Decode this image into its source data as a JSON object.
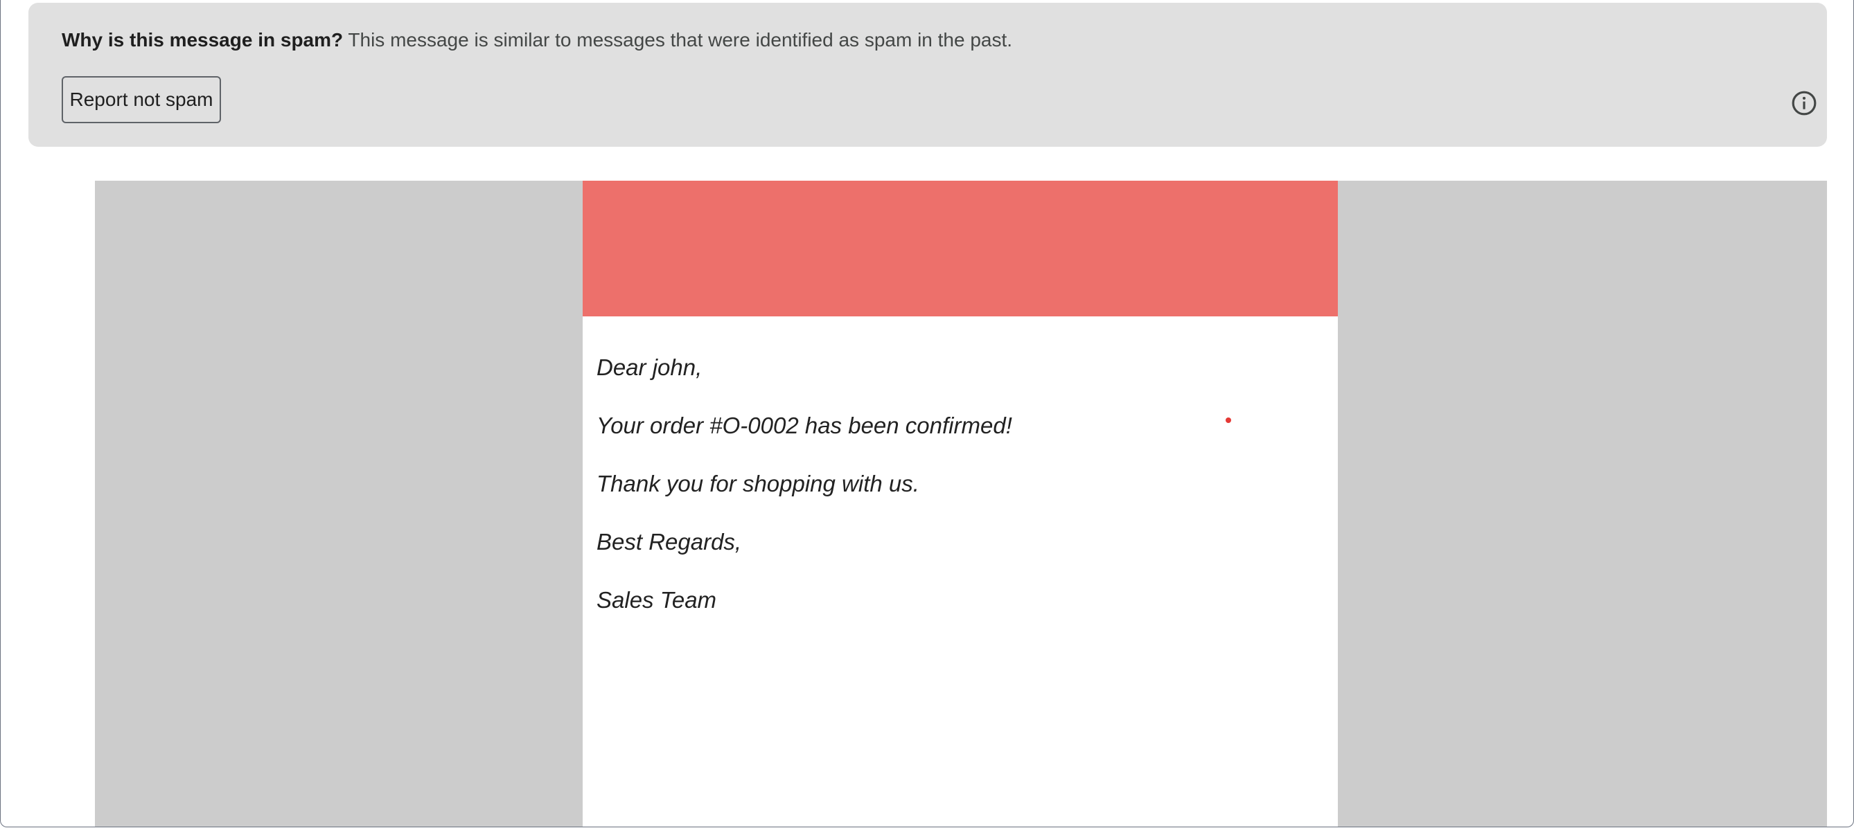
{
  "spam_banner": {
    "question": "Why is this message in spam?",
    "explanation": " This message is similar to messages that were identified as spam in the past.",
    "report_button_label": "Report not spam",
    "info_icon": "info-icon"
  },
  "email": {
    "header_color": "#ed706b",
    "lines": [
      "Dear john,",
      "Your order #O-0002 has been confirmed!",
      "Thank you for shopping with us.",
      "Best Regards,",
      "Sales Team"
    ]
  }
}
